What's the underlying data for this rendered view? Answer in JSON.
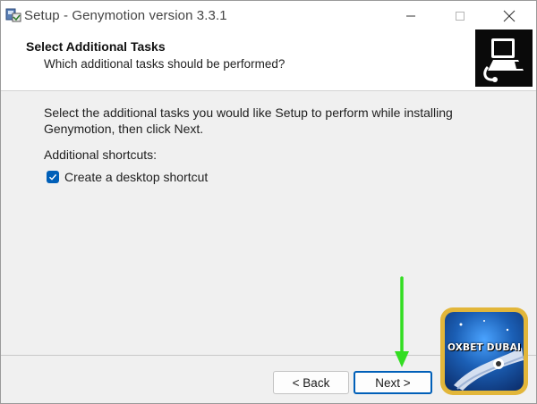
{
  "window": {
    "title": "Setup - Genymotion version 3.3.1"
  },
  "header": {
    "title": "Select Additional Tasks",
    "subtitle": "Which additional tasks should be performed?"
  },
  "body": {
    "instructions": "Select the additional tasks you would like Setup to perform while installing Genymotion, then click Next.",
    "shortcuts_label": "Additional shortcuts:",
    "desktop_shortcut": {
      "label": "Create a desktop shortcut",
      "checked": true
    }
  },
  "buttons": {
    "back": "< Back",
    "next": "Next >"
  },
  "overlay": {
    "badge_text": "OXBET DUBAI",
    "arrow_color": "#33dd22"
  },
  "colors": {
    "accent": "#005fb8"
  }
}
